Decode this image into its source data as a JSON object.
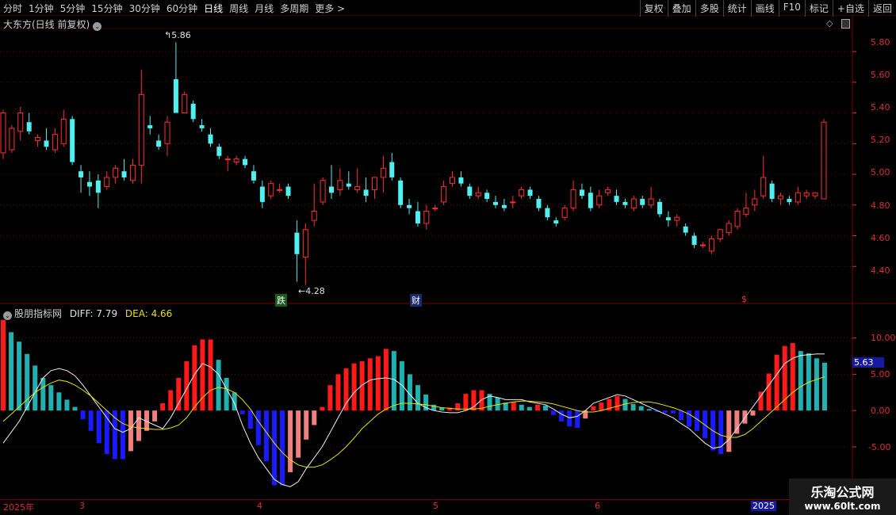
{
  "toolbar": {
    "left": [
      "分时",
      "1分钟",
      "5分钟",
      "15分钟",
      "30分钟",
      "60分钟",
      "日线",
      "周线",
      "月线",
      "多周期",
      "更多 >"
    ],
    "active": "日线",
    "right": [
      "复权",
      "叠加",
      "多股",
      "统计",
      "画线",
      "F10",
      "标记",
      "+自选",
      "返回"
    ]
  },
  "main_panel": {
    "title": "大东方(日线 前复权)",
    "high_label": "5.86",
    "low_label": "4.28",
    "markers": [
      "跌",
      "财",
      "$"
    ],
    "y_ticks": [
      "5.80",
      "5.60",
      "5.40",
      "5.20",
      "5.00",
      "4.80",
      "4.60",
      "4.40"
    ]
  },
  "macd_panel": {
    "title": "股朋指标网",
    "diff_label": "DIFF: 7.79",
    "dea_label": "DEA: 4.66",
    "y_ticks": [
      "10.00",
      "5.00",
      "0.00",
      "-5.00"
    ],
    "current_value": "5.63"
  },
  "date_axis": [
    "2025年",
    "3",
    "4",
    "5",
    "6",
    "2025"
  ],
  "watermark": {
    "line1": "乐淘公式网",
    "line2": "www.60lt.com"
  },
  "colors": {
    "up": "#ff3030",
    "down": "#50f0f0",
    "macd_red": "#ff1a1a",
    "macd_pink": "#f08080",
    "macd_blue": "#1a1aff",
    "macd_teal": "#20b0b0",
    "grid": "#5a0000"
  },
  "chart_data": [
    {
      "type": "candlestick",
      "title": "大东方(日线 前复权)",
      "ylim": [
        4.2,
        5.95
      ],
      "ohlc": [
        [
          5.14,
          5.42,
          5.1,
          5.4
        ],
        [
          5.16,
          5.32,
          5.14,
          5.3
        ],
        [
          5.28,
          5.44,
          5.22,
          5.4
        ],
        [
          5.34,
          5.4,
          5.26,
          5.28
        ],
        [
          5.22,
          5.26,
          5.18,
          5.24
        ],
        [
          5.22,
          5.3,
          5.16,
          5.18
        ],
        [
          5.16,
          5.3,
          5.14,
          5.26
        ],
        [
          5.2,
          5.42,
          5.18,
          5.36
        ],
        [
          5.36,
          5.38,
          5.06,
          5.08
        ],
        [
          5.02,
          5.06,
          4.88,
          4.98
        ],
        [
          4.95,
          5.02,
          4.86,
          4.92
        ],
        [
          4.96,
          5.0,
          4.78,
          4.88
        ],
        [
          4.92,
          5.02,
          4.9,
          4.98
        ],
        [
          4.98,
          5.06,
          4.94,
          5.04
        ],
        [
          5.02,
          5.1,
          4.96,
          4.98
        ],
        [
          4.96,
          5.1,
          4.94,
          5.06
        ],
        [
          5.06,
          5.68,
          4.94,
          5.52
        ],
        [
          5.32,
          5.38,
          5.26,
          5.3
        ],
        [
          5.22,
          5.26,
          5.16,
          5.18
        ],
        [
          5.2,
          5.38,
          5.12,
          5.34
        ],
        [
          5.62,
          5.86,
          5.4,
          5.4
        ],
        [
          5.4,
          5.54,
          5.4,
          5.52
        ],
        [
          5.46,
          5.48,
          5.34,
          5.36
        ],
        [
          5.32,
          5.36,
          5.28,
          5.3
        ],
        [
          5.26,
          5.3,
          5.18,
          5.2
        ],
        [
          5.18,
          5.2,
          5.1,
          5.12
        ],
        [
          5.1,
          5.12,
          5.02,
          5.1
        ],
        [
          5.08,
          5.12,
          5.06,
          5.1
        ],
        [
          5.1,
          5.12,
          5.04,
          5.06
        ],
        [
          5.02,
          5.06,
          4.94,
          4.96
        ],
        [
          4.92,
          4.96,
          4.78,
          4.82
        ],
        [
          4.86,
          4.96,
          4.84,
          4.94
        ],
        [
          4.9,
          4.94,
          4.88,
          4.9
        ],
        [
          4.92,
          4.94,
          4.84,
          4.86
        ],
        [
          4.62,
          4.7,
          4.3,
          4.48
        ],
        [
          4.46,
          4.68,
          4.28,
          4.64
        ],
        [
          4.7,
          4.94,
          4.66,
          4.76
        ],
        [
          4.82,
          4.98,
          4.8,
          4.96
        ],
        [
          4.92,
          5.06,
          4.84,
          4.88
        ],
        [
          4.9,
          5.04,
          4.86,
          4.96
        ],
        [
          4.94,
          5.02,
          4.9,
          4.92
        ],
        [
          4.9,
          5.04,
          4.88,
          4.92
        ],
        [
          4.9,
          4.98,
          4.82,
          4.86
        ],
        [
          4.9,
          4.98,
          4.84,
          4.98
        ],
        [
          4.98,
          5.12,
          4.88,
          5.04
        ],
        [
          5.08,
          5.14,
          4.96,
          4.98
        ],
        [
          4.96,
          4.98,
          4.78,
          4.8
        ],
        [
          4.8,
          4.84,
          4.74,
          4.78
        ],
        [
          4.76,
          4.82,
          4.66,
          4.68
        ],
        [
          4.68,
          4.8,
          4.64,
          4.76
        ],
        [
          4.78,
          4.8,
          4.76,
          4.78
        ],
        [
          4.82,
          4.96,
          4.8,
          4.92
        ],
        [
          4.94,
          5.02,
          4.92,
          4.98
        ],
        [
          4.98,
          5.02,
          4.92,
          4.94
        ],
        [
          4.92,
          4.94,
          4.84,
          4.86
        ],
        [
          4.86,
          4.92,
          4.84,
          4.88
        ],
        [
          4.88,
          4.9,
          4.82,
          4.84
        ],
        [
          4.82,
          4.86,
          4.78,
          4.8
        ],
        [
          4.8,
          4.84,
          4.76,
          4.78
        ],
        [
          4.82,
          4.86,
          4.78,
          4.82
        ],
        [
          4.86,
          4.92,
          4.84,
          4.9
        ],
        [
          4.9,
          4.92,
          4.84,
          4.86
        ],
        [
          4.84,
          4.86,
          4.76,
          4.78
        ],
        [
          4.78,
          4.8,
          4.7,
          4.72
        ],
        [
          4.7,
          4.72,
          4.66,
          4.68
        ],
        [
          4.72,
          4.8,
          4.7,
          4.78
        ],
        [
          4.78,
          4.96,
          4.76,
          4.9
        ],
        [
          4.9,
          4.94,
          4.84,
          4.86
        ],
        [
          4.88,
          4.92,
          4.76,
          4.78
        ],
        [
          4.8,
          4.9,
          4.78,
          4.86
        ],
        [
          4.88,
          4.92,
          4.86,
          4.9
        ],
        [
          4.86,
          4.9,
          4.8,
          4.82
        ],
        [
          4.82,
          4.84,
          4.78,
          4.8
        ],
        [
          4.78,
          4.86,
          4.76,
          4.84
        ],
        [
          4.84,
          4.86,
          4.78,
          4.8
        ],
        [
          4.8,
          4.92,
          4.78,
          4.84
        ],
        [
          4.82,
          4.84,
          4.72,
          4.74
        ],
        [
          4.72,
          4.76,
          4.66,
          4.7
        ],
        [
          4.7,
          4.74,
          4.66,
          4.72
        ],
        [
          4.66,
          4.68,
          4.6,
          4.62
        ],
        [
          4.6,
          4.62,
          4.52,
          4.54
        ],
        [
          4.54,
          4.56,
          4.52,
          4.54
        ],
        [
          4.5,
          4.6,
          4.48,
          4.58
        ],
        [
          4.58,
          4.64,
          4.56,
          4.64
        ],
        [
          4.62,
          4.7,
          4.6,
          4.68
        ],
        [
          4.66,
          4.78,
          4.64,
          4.76
        ],
        [
          4.74,
          4.88,
          4.72,
          4.78
        ],
        [
          4.8,
          4.9,
          4.76,
          4.84
        ],
        [
          4.86,
          5.12,
          4.84,
          4.98
        ],
        [
          4.94,
          4.96,
          4.82,
          4.84
        ],
        [
          4.84,
          4.88,
          4.8,
          4.86
        ],
        [
          4.84,
          4.86,
          4.8,
          4.82
        ],
        [
          4.82,
          4.92,
          4.8,
          4.88
        ],
        [
          4.86,
          4.9,
          4.84,
          4.88
        ],
        [
          4.86,
          4.88,
          4.84,
          4.88
        ],
        [
          4.84,
          5.36,
          4.84,
          5.34
        ]
      ]
    },
    {
      "type": "bar",
      "title": "股朋指标网",
      "series_names": [
        "DIFF",
        "DEA"
      ],
      "ylim": [
        -12,
        14
      ],
      "macd": [
        12.5,
        10.8,
        9.5,
        7.8,
        6.2,
        4.5,
        3.5,
        2.5,
        1.5,
        0.5,
        -1.2,
        -2.8,
        -4.5,
        -6.0,
        -6.7,
        -6.7,
        -5.6,
        -4.2,
        -2.8,
        -1.5,
        1.0,
        2.8,
        4.5,
        6.8,
        9.0,
        9.8,
        9.8,
        7.0,
        4.5,
        2.5,
        -0.5,
        -2.5,
        -4.8,
        -7.0,
        -10.3,
        -10.3,
        -8.5,
        -6.5,
        -4.0,
        -2.0,
        0.5,
        3.5,
        5.0,
        5.8,
        6.5,
        6.8,
        7.2,
        7.5,
        8.5,
        8.2,
        6.8,
        5.0,
        3.5,
        2.2,
        0.8,
        0.4,
        0.4,
        1.0,
        2.3,
        2.8,
        2.8,
        2.3,
        1.8,
        1.1,
        1.2,
        0.8,
        0.5,
        0.8,
        0.7,
        -0.6,
        -1.5,
        -2.2,
        -2.4,
        -1.1,
        0.6,
        1.1,
        1.6,
        2.0,
        1.6,
        0.9,
        0.6,
        0.2,
        -0.2,
        -0.3,
        -0.4,
        -1.3,
        -2.2,
        -2.8,
        -3.8,
        -5.5,
        -6.0,
        -5.7,
        -3.2,
        -1.8,
        -0.7,
        2.6,
        5.1,
        7.7,
        8.9,
        9.3,
        8.2,
        7.9,
        7.2,
        6.6
      ],
      "diff": [
        -4.5,
        -3.0,
        -1.5,
        0.5,
        2.5,
        4.5,
        5.5,
        5.8,
        5.5,
        4.8,
        3.5,
        2.0,
        0.5,
        -1.0,
        -2.5,
        -3.0,
        -2.5,
        -1.0,
        -1.5,
        -2.0,
        -2.5,
        -1.0,
        1.0,
        3.0,
        5.0,
        6.5,
        6.0,
        5.0,
        3.0,
        1.0,
        -2.0,
        -4.5,
        -6.5,
        -8.0,
        -9.5,
        -10.2,
        -10.5,
        -9.8,
        -8.0,
        -6.5,
        -5.0,
        -3.0,
        -1.0,
        1.0,
        2.5,
        3.5,
        4.2,
        4.4,
        4.5,
        4.3,
        3.5,
        2.2,
        1.0,
        0.4,
        0.0,
        -0.2,
        -0.3,
        -0.3,
        0.0,
        0.5,
        1.5,
        2.0,
        1.8,
        1.5,
        1.5,
        1.5,
        1.2,
        1.0,
        0.8,
        0.2,
        -0.5,
        -1.0,
        -0.8,
        0.0,
        1.0,
        1.4,
        1.8,
        2.2,
        2.0,
        1.5,
        1.0,
        0.5,
        0.0,
        -0.5,
        -1.0,
        -1.8,
        -2.5,
        -3.5,
        -4.5,
        -5.2,
        -5.0,
        -4.0,
        -2.5,
        -1.0,
        0.5,
        2.0,
        3.5,
        5.0,
        6.5,
        7.2,
        7.6,
        7.7,
        7.8,
        7.79
      ],
      "dea": [
        -1.5,
        -0.5,
        0.5,
        1.5,
        2.5,
        3.2,
        3.8,
        4.2,
        4.0,
        3.5,
        2.8,
        2.0,
        1.0,
        0.0,
        -1.0,
        -1.8,
        -2.2,
        -2.4,
        -2.5,
        -2.6,
        -2.6,
        -2.4,
        -2.0,
        -1.0,
        0.5,
        1.8,
        2.8,
        3.2,
        3.0,
        2.5,
        1.5,
        0.2,
        -1.5,
        -3.0,
        -4.5,
        -5.8,
        -6.8,
        -7.5,
        -7.8,
        -7.8,
        -7.5,
        -6.8,
        -6.0,
        -5.0,
        -3.8,
        -2.5,
        -1.5,
        -0.5,
        0.2,
        0.7,
        1.0,
        1.0,
        0.9,
        0.8,
        0.6,
        0.4,
        0.3,
        0.2,
        0.2,
        0.2,
        0.3,
        0.6,
        0.8,
        1.0,
        1.2,
        1.3,
        1.3,
        1.2,
        1.1,
        0.9,
        0.6,
        0.3,
        0.0,
        -0.2,
        -0.2,
        0.0,
        0.3,
        0.6,
        0.9,
        1.1,
        1.2,
        1.2,
        1.0,
        0.7,
        0.4,
        0.0,
        -0.5,
        -1.2,
        -2.0,
        -2.8,
        -3.4,
        -3.7,
        -3.7,
        -3.3,
        -2.5,
        -1.5,
        -0.5,
        0.5,
        1.5,
        2.5,
        3.3,
        3.9,
        4.3,
        4.66
      ]
    }
  ]
}
